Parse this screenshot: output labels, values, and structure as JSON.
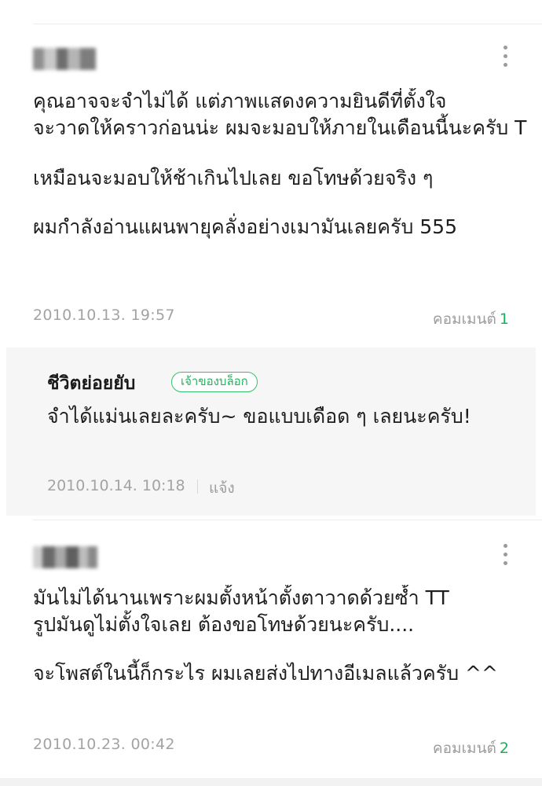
{
  "comments": [
    {
      "lines": [
        "คุณอาจจะจำไม่ได้ แต่ภาพแสดงความยินดีที่ตั้งใจ",
        "จะวาดให้คราวก่อนน่ะ ผมจะมอบให้ภายในเดือนนี้นะครับ T",
        "เหมือนจะมอบให้ช้าเกินไปเลย ขอโทษด้วยจริง ๆ",
        "ผมกำลังอ่านแผนพายุคลั่งอย่างเมามันเลยครับ 555"
      ],
      "date": "2010.10.13. 19:57",
      "comment_label": "คอมเมนต์",
      "comment_count": "1"
    },
    {
      "lines": [
        "มันไม่ได้นานเพราะผมตั้งหน้าตั้งตาวาดด้วยซ้ำ TT",
        "รูปมันดูไม่ตั้งใจเลย ต้องขอโทษด้วยนะครับ....",
        "จะโพสต์ในนี้ก็กระไร ผมเลยส่งไปทางอีเมลแล้วครับ ^^"
      ],
      "date": "2010.10.23. 00:42",
      "comment_label": "คอมเมนต์",
      "comment_count": "2"
    }
  ],
  "reply": {
    "author": "ชีวิตย่อยยับ",
    "badge": "เจ้าของบล็อก",
    "text": "จำได้แม่นเลยละครับ~ ขอแบบเดือด ๆ เลยนะครับ!",
    "date": "2010.10.14. 10:18",
    "report_label": "แจ้ง"
  },
  "colors": {
    "accent_green": "#16b45a",
    "meta_gray": "#a3a3a3",
    "reply_bg": "#f6f6f6"
  },
  "icons": {
    "more": "more-vertical-icon",
    "avatar": "blurred-avatar"
  }
}
